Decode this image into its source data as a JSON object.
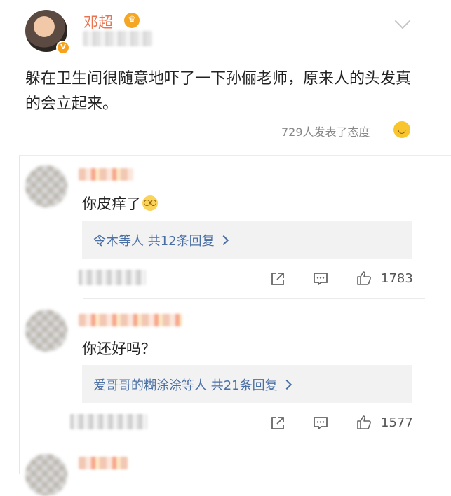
{
  "post": {
    "author": "邓超",
    "text": "躲在卫生间很随意地吓了一下孙俪老师，原来人的头发真的会立起来。",
    "attitudes": "729人发表了态度"
  },
  "comments": [
    {
      "text": "你皮痒了",
      "reply_summary": "令木等人 共12条回复",
      "like_count": "1783"
    },
    {
      "text": "你还好吗？",
      "reply_summary": "爱哥哥的糊涂涂等人 共21条回复",
      "like_count": "1577"
    }
  ],
  "icons": {
    "verified": "verified-badge-icon",
    "crown": "crown-icon",
    "menu": "chevron-down-icon",
    "attitude": "smile-emoji-icon",
    "share": "share-icon",
    "comment": "comment-icon",
    "like": "thumbs-up-icon",
    "reply_arrow": "chevron-right-icon"
  },
  "colors": {
    "author_name": "#eb7350",
    "reply_link": "#4a6fa5",
    "reply_bg": "#f2f2f2",
    "muted_text": "#888888"
  }
}
